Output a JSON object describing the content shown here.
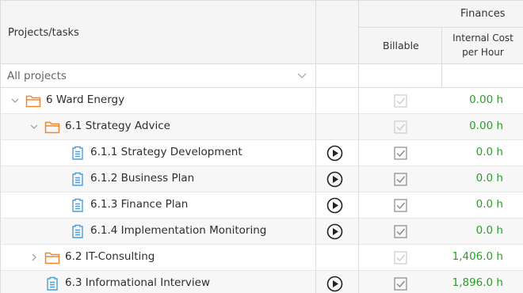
{
  "header": {
    "projects_tasks_label": "Projects/tasks",
    "finances_label": "Finances",
    "billable_label": "Billable",
    "internal_cost_line1": "Internal Cost",
    "internal_cost_line2": "per Hour"
  },
  "filter": {
    "value": "All projects"
  },
  "colors": {
    "folder": "#f0882a",
    "task": "#4a9fd8",
    "cost_green": "#2a9d2a",
    "check_active": "#888888",
    "check_muted": "#cccccc"
  },
  "rows": [
    {
      "label": "6 Ward Energy",
      "type": "folder",
      "expand": "down",
      "level": 0,
      "play": false,
      "billable_muted": true,
      "cost": "0.00 h"
    },
    {
      "label": "6.1 Strategy Advice",
      "type": "folder",
      "expand": "down",
      "level": 1,
      "play": false,
      "billable_muted": true,
      "cost": "0.00 h"
    },
    {
      "label": "6.1.1 Strategy Development",
      "type": "task",
      "expand": "none",
      "level": 2,
      "play": true,
      "billable_muted": false,
      "cost": "0.0 h"
    },
    {
      "label": "6.1.2 Business Plan",
      "type": "task",
      "expand": "none",
      "level": 2,
      "play": true,
      "billable_muted": false,
      "cost": "0.0 h"
    },
    {
      "label": "6.1.3 Finance Plan",
      "type": "task",
      "expand": "none",
      "level": 2,
      "play": true,
      "billable_muted": false,
      "cost": "0.0 h"
    },
    {
      "label": "6.1.4 Implementation Monitoring",
      "type": "task",
      "expand": "none",
      "level": 2,
      "play": true,
      "billable_muted": false,
      "cost": "0.0 h"
    },
    {
      "label": "6.2 IT-Consulting",
      "type": "folder",
      "expand": "right",
      "level": 1,
      "play": false,
      "billable_muted": true,
      "cost": "1,406.0 h"
    },
    {
      "label": "6.3 Informational Interview",
      "type": "task",
      "expand": "none",
      "level": 1,
      "play": true,
      "billable_muted": false,
      "cost": "1,896.0 h"
    }
  ]
}
